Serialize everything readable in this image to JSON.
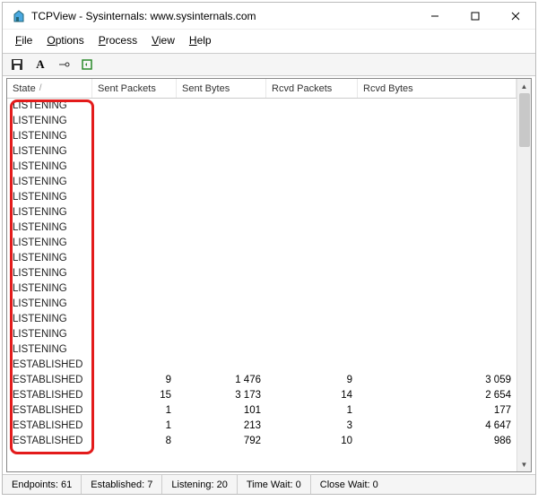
{
  "window": {
    "title": "TCPView - Sysinternals: www.sysinternals.com"
  },
  "menu": {
    "file": "File",
    "options": "Options",
    "process": "Process",
    "view": "View",
    "help": "Help"
  },
  "columns": {
    "state": "State",
    "sent_packets": "Sent Packets",
    "sent_bytes": "Sent Bytes",
    "rcvd_packets": "Rcvd Packets",
    "rcvd_bytes": "Rcvd Bytes"
  },
  "rows": [
    {
      "state": "LISTENING",
      "sp": "",
      "sb": "",
      "rp": "",
      "rb": ""
    },
    {
      "state": "LISTENING",
      "sp": "",
      "sb": "",
      "rp": "",
      "rb": ""
    },
    {
      "state": "LISTENING",
      "sp": "",
      "sb": "",
      "rp": "",
      "rb": ""
    },
    {
      "state": "LISTENING",
      "sp": "",
      "sb": "",
      "rp": "",
      "rb": ""
    },
    {
      "state": "LISTENING",
      "sp": "",
      "sb": "",
      "rp": "",
      "rb": ""
    },
    {
      "state": "LISTENING",
      "sp": "",
      "sb": "",
      "rp": "",
      "rb": ""
    },
    {
      "state": "LISTENING",
      "sp": "",
      "sb": "",
      "rp": "",
      "rb": ""
    },
    {
      "state": "LISTENING",
      "sp": "",
      "sb": "",
      "rp": "",
      "rb": ""
    },
    {
      "state": "LISTENING",
      "sp": "",
      "sb": "",
      "rp": "",
      "rb": ""
    },
    {
      "state": "LISTENING",
      "sp": "",
      "sb": "",
      "rp": "",
      "rb": ""
    },
    {
      "state": "LISTENING",
      "sp": "",
      "sb": "",
      "rp": "",
      "rb": ""
    },
    {
      "state": "LISTENING",
      "sp": "",
      "sb": "",
      "rp": "",
      "rb": ""
    },
    {
      "state": "LISTENING",
      "sp": "",
      "sb": "",
      "rp": "",
      "rb": ""
    },
    {
      "state": "LISTENING",
      "sp": "",
      "sb": "",
      "rp": "",
      "rb": ""
    },
    {
      "state": "LISTENING",
      "sp": "",
      "sb": "",
      "rp": "",
      "rb": ""
    },
    {
      "state": "LISTENING",
      "sp": "",
      "sb": "",
      "rp": "",
      "rb": ""
    },
    {
      "state": "LISTENING",
      "sp": "",
      "sb": "",
      "rp": "",
      "rb": ""
    },
    {
      "state": "ESTABLISHED",
      "sp": "",
      "sb": "",
      "rp": "",
      "rb": ""
    },
    {
      "state": "ESTABLISHED",
      "sp": "9",
      "sb": "1 476",
      "rp": "9",
      "rb": "3 059"
    },
    {
      "state": "ESTABLISHED",
      "sp": "15",
      "sb": "3 173",
      "rp": "14",
      "rb": "2 654"
    },
    {
      "state": "ESTABLISHED",
      "sp": "1",
      "sb": "101",
      "rp": "1",
      "rb": "177"
    },
    {
      "state": "ESTABLISHED",
      "sp": "1",
      "sb": "213",
      "rp": "3",
      "rb": "4 647"
    },
    {
      "state": "ESTABLISHED",
      "sp": "8",
      "sb": "792",
      "rp": "10",
      "rb": "986"
    }
  ],
  "status": {
    "endpoints_label": "Endpoints:",
    "endpoints_value": "61",
    "established_label": "Established:",
    "established_value": "7",
    "listening_label": "Listening:",
    "listening_value": "20",
    "timewait_label": "Time Wait:",
    "timewait_value": "0",
    "closewait_label": "Close Wait:",
    "closewait_value": "0"
  }
}
